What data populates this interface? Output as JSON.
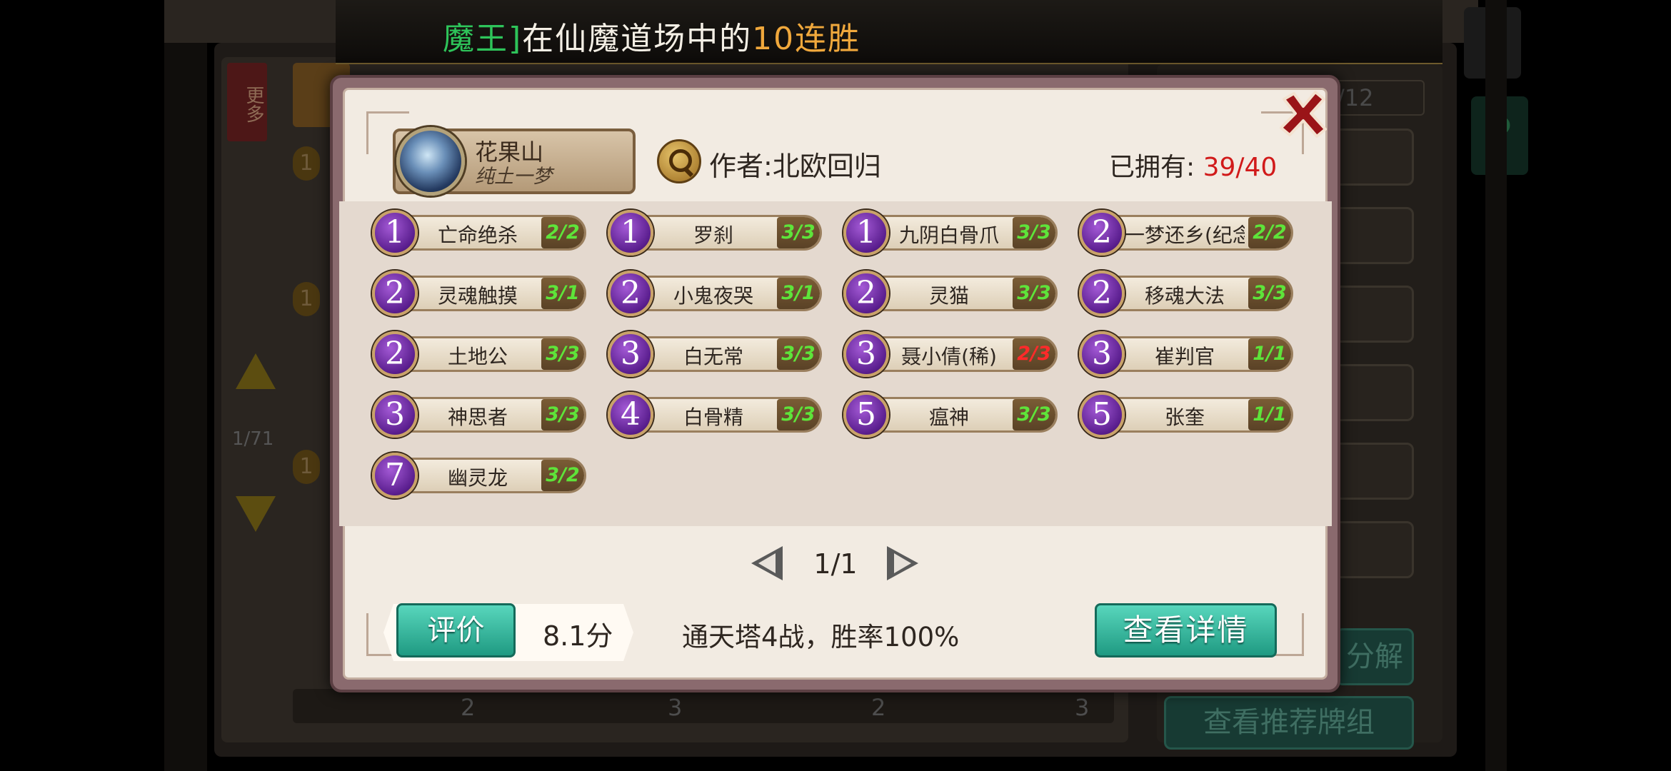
{
  "marquee": {
    "part1": "魔王]",
    "part2": "在仙魔道场中的",
    "part3": "10连胜"
  },
  "background": {
    "tab_more": "更多",
    "page_indicator": "1/71",
    "counter": "/12",
    "side_labels": [
      "1",
      "1",
      "1"
    ],
    "bottom_numbers": [
      "2",
      "3",
      "2",
      "3"
    ],
    "decompose_button": "分解",
    "recommend_button": "查看推荐牌组",
    "help_icon": "?"
  },
  "deck": {
    "name": "花果山",
    "subtitle": "纯土一梦",
    "author_label": "作者:",
    "author": "北欧回归",
    "owned_label": "已拥有:",
    "owned_value": "39/40"
  },
  "cards": [
    {
      "cost": "1",
      "name": "亡命绝杀",
      "count": "2/2",
      "warn": false
    },
    {
      "cost": "1",
      "name": "罗刹",
      "count": "3/3",
      "warn": false
    },
    {
      "cost": "1",
      "name": "九阴白骨爪",
      "count": "3/3",
      "warn": false
    },
    {
      "cost": "2",
      "name": "一梦还乡(纪念",
      "count": "2/2",
      "warn": false
    },
    {
      "cost": "2",
      "name": "灵魂触摸",
      "count": "3/1",
      "warn": false
    },
    {
      "cost": "2",
      "name": "小鬼夜哭",
      "count": "3/1",
      "warn": false
    },
    {
      "cost": "2",
      "name": "灵猫",
      "count": "3/3",
      "warn": false
    },
    {
      "cost": "2",
      "name": "移魂大法",
      "count": "3/3",
      "warn": false
    },
    {
      "cost": "2",
      "name": "土地公",
      "count": "3/3",
      "warn": false
    },
    {
      "cost": "3",
      "name": "白无常",
      "count": "3/3",
      "warn": false
    },
    {
      "cost": "3",
      "name": "聂小倩(稀)",
      "count": "2/3",
      "warn": true
    },
    {
      "cost": "3",
      "name": "崔判官",
      "count": "1/1",
      "warn": false
    },
    {
      "cost": "3",
      "name": "神思者",
      "count": "3/3",
      "warn": false
    },
    {
      "cost": "4",
      "name": "白骨精",
      "count": "3/3",
      "warn": false
    },
    {
      "cost": "5",
      "name": "瘟神",
      "count": "3/3",
      "warn": false
    },
    {
      "cost": "5",
      "name": "张奎",
      "count": "1/1",
      "warn": false
    },
    {
      "cost": "7",
      "name": "幽灵龙",
      "count": "3/2",
      "warn": false
    }
  ],
  "pager": {
    "text": "1/1"
  },
  "footer": {
    "rate_label": "评价",
    "score": "8.1分",
    "stats": "通天塔4战，胜率100%",
    "detail_label": "查看详情"
  },
  "colors": {
    "accent_teal": "#2bb39a",
    "owned_red": "#d11a1a",
    "count_green": "#5ee43a",
    "cost_purple": "#5a1e8e"
  }
}
